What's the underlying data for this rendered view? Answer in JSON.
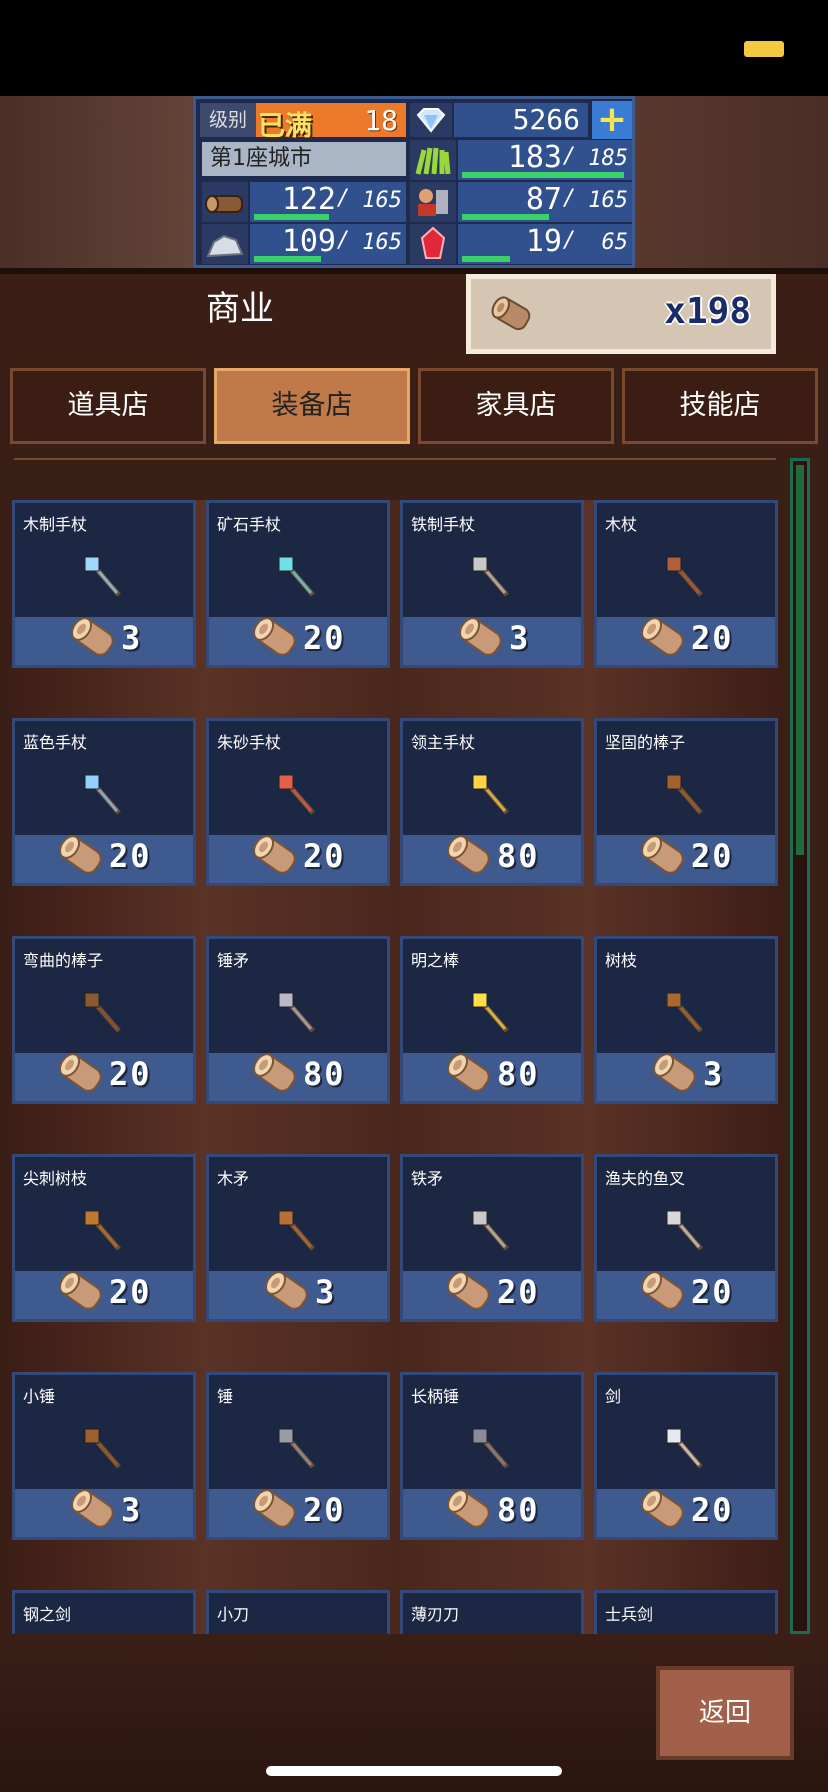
{
  "stats": {
    "level_label": "级别",
    "level_tag": "已满",
    "level": "18",
    "diamonds": "5266",
    "plus_label": "+",
    "city": "第1座城市",
    "wood": {
      "cur": "122",
      "max": "165",
      "fill": 0.74
    },
    "food": {
      "cur": "183",
      "max": "185",
      "fill": 0.99
    },
    "stone": {
      "cur": "109",
      "max": "165",
      "fill": 0.66
    },
    "soldier": {
      "cur": "87",
      "max": "165",
      "fill": 0.53
    },
    "gem": {
      "cur": "19",
      "max": "65",
      "fill": 0.29
    }
  },
  "header": {
    "title": "商业",
    "currency": "x198"
  },
  "tabs": [
    {
      "label": "道具店",
      "active": false
    },
    {
      "label": "装备店",
      "active": true
    },
    {
      "label": "家具店",
      "active": false
    },
    {
      "label": "技能店",
      "active": false
    }
  ],
  "items": [
    {
      "name": "木制手杖",
      "price": "3",
      "icon": "wood-staff-icon",
      "color": "#9fd8ff"
    },
    {
      "name": "矿石手杖",
      "price": "20",
      "icon": "ore-staff-icon",
      "color": "#6fe0e6"
    },
    {
      "name": "铁制手杖",
      "price": "3",
      "icon": "iron-staff-icon",
      "color": "#c8c8c8"
    },
    {
      "name": "木杖",
      "price": "20",
      "icon": "wood-rod-icon",
      "color": "#b0603a"
    },
    {
      "name": "蓝色手杖",
      "price": "20",
      "icon": "blue-staff-icon",
      "color": "#8fd0ff"
    },
    {
      "name": "朱砂手杖",
      "price": "20",
      "icon": "cinnabar-staff-icon",
      "color": "#e0604a"
    },
    {
      "name": "领主手杖",
      "price": "80",
      "icon": "lord-staff-icon",
      "color": "#ffd24a"
    },
    {
      "name": "坚固的棒子",
      "price": "20",
      "icon": "sturdy-club-icon",
      "color": "#a2622e"
    },
    {
      "name": "弯曲的棒子",
      "price": "20",
      "icon": "bent-club-icon",
      "color": "#8a5a2e"
    },
    {
      "name": "锤矛",
      "price": "80",
      "icon": "mace-icon",
      "color": "#b8b8c8"
    },
    {
      "name": "明之棒",
      "price": "80",
      "icon": "bright-rod-icon",
      "color": "#ffe04a"
    },
    {
      "name": "树枝",
      "price": "3",
      "icon": "branch-icon",
      "color": "#a8682e"
    },
    {
      "name": "尖刺树枝",
      "price": "20",
      "icon": "spiked-branch-icon",
      "color": "#c0782e"
    },
    {
      "name": "木矛",
      "price": "3",
      "icon": "wood-spear-icon",
      "color": "#b8703a"
    },
    {
      "name": "铁矛",
      "price": "20",
      "icon": "iron-spear-icon",
      "color": "#c8c8c8"
    },
    {
      "name": "渔夫的鱼叉",
      "price": "20",
      "icon": "harpoon-icon",
      "color": "#d8d8d8"
    },
    {
      "name": "小锤",
      "price": "3",
      "icon": "small-hammer-icon",
      "color": "#a0602e"
    },
    {
      "name": "锤",
      "price": "20",
      "icon": "hammer-icon",
      "color": "#9a9aa8"
    },
    {
      "name": "长柄锤",
      "price": "80",
      "icon": "long-hammer-icon",
      "color": "#8a8a9a"
    },
    {
      "name": "剑",
      "price": "20",
      "icon": "sword-icon",
      "color": "#e8e8f0"
    },
    {
      "name": "钢之剑",
      "price": "",
      "icon": "steel-sword-icon",
      "color": "#d0d0e0"
    },
    {
      "name": "小刀",
      "price": "",
      "icon": "knife-icon",
      "color": "#d0d0e0"
    },
    {
      "name": "薄刃刀",
      "price": "",
      "icon": "thin-blade-icon",
      "color": "#d0d0e0"
    },
    {
      "name": "士兵剑",
      "price": "",
      "icon": "soldier-sword-icon",
      "color": "#d0d0e0"
    }
  ],
  "footer": {
    "back_label": "返回"
  }
}
